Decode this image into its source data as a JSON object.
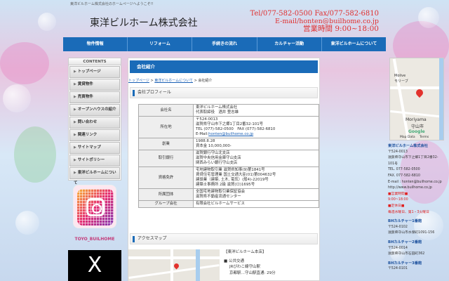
{
  "page": {
    "tagline": "東洋ビルホーム株式会社のホームページへようこそ!!",
    "site_title": "東洋ビルホーム株式会社"
  },
  "contact": {
    "tel_fax": "Tel/077-582-0500 Fax/077-582-6810",
    "email": "E-mail/honten@builhome.co.jp",
    "hours": "営業時間 9:00~18:00"
  },
  "nav": {
    "items": [
      "物件情報",
      "リフォーム",
      "手続きの流れ",
      "カルチャー活動",
      "東洋ビルホームについて"
    ]
  },
  "sidebar": {
    "heading": "CONTENTS",
    "items": [
      "トップページ",
      "賃貸物件",
      "売買物件",
      "オープンハウスの紹介",
      "問い合わせ",
      "関連リンク",
      "サイトマップ",
      "サイトポリシー",
      "東洋ビルホームについて"
    ]
  },
  "instagram": {
    "label": "TOYO_BUILHOME"
  },
  "x_logo": {
    "glyph": "X"
  },
  "main": {
    "heading": "会社紹介",
    "breadcrumb": {
      "home": "トップページ",
      "sep": ">",
      "parent": "東洋ビルホームについて",
      "current": "会社紹介"
    },
    "profile_heading": "会社プロフィール",
    "access_heading": "アクセスマップ",
    "profile": [
      {
        "label": "会社名",
        "lines": [
          "東洋ビルホーム株式会社",
          "代表取締役　酒井 登志雄"
        ]
      },
      {
        "label": "所在地",
        "lines": [
          "〒524-0013",
          "滋賀県守山市下之郷1丁目2番32-101号",
          "TEL (077)-582-0500　FAX (077)-582-6810"
        ],
        "email_prefix": "E-Mail:",
        "email": "honten@builhome.co.jp"
      },
      {
        "label": "創業",
        "lines": [
          "1988.8.28",
          "資本金 10,000,000-"
        ]
      },
      {
        "label": "取引銀行",
        "lines": [
          "滋賀銀行守山北支店",
          "滋賀中央信用金庫守山支店",
          "関西みらい銀行守山支店"
        ]
      },
      {
        "label": "資格免許",
        "lines": [
          "宅地建物取引業 滋賀県知事(9)第1841号",
          "賃貸住宅管理業 国土交通大臣(01)第004632号",
          "建設業（建築, 土木, 電気）(般4)-22019号",
          "建築士事務所 2級 滋賀(ロ)1695号"
        ]
      },
      {
        "label": "所属団体",
        "lines": [
          "全国宅地建物取引業保証協会",
          "滋賀県不動産流通センター"
        ]
      },
      {
        "label": "グループ会社",
        "lines": [
          "有限会社ビルホームサービス"
        ]
      }
    ],
    "access": {
      "office": "【東洋ビルホーム本店】",
      "bullet": "■ 公共交通",
      "line1": "JRびわこ線守山駅",
      "line2": "京都駅…守山駅直通: 29分"
    }
  },
  "gmap": {
    "place_en": "Moriyama",
    "place_jp": "守山市",
    "poi": "Molive",
    "poi_jp": "モリーブ",
    "attribution": "Map Data",
    "terms": "Terms",
    "brand": "Google"
  },
  "right_info": {
    "company": "東洋ビルホーム株式会社",
    "zip": "〒524-0013",
    "addr1": "滋賀県守山市下之郷1丁目2番32-",
    "addr2": "101号",
    "tel": "TEL. 077-582-0500",
    "fax": "FAX. 077-582-6810",
    "email": "E-mail : honten@builhome.co.jp",
    "url": "http://www.builhome.co.jp",
    "hours_label": "■営業時間■",
    "hours": "9:00~18:00",
    "closed_label": "■定休日■",
    "closed": "毎週水曜日、第1・3火曜日",
    "branch1_name": "BHカルチャー1番館",
    "branch1_zip": "〒524-0102",
    "branch1_addr": "滋賀県守山市水保町1091-156",
    "branch2_name": "BHカルチャー2番館",
    "branch2_zip": "〒524-0014",
    "branch2_addr": "滋賀県守山市石田町362",
    "branch3_name": "BHカルチャー3番館",
    "branch3_zip": "〒524-0101"
  },
  "colors": {
    "nav": "#1a6bb8",
    "accent_red": "#e03030",
    "link": "#1a5fb4"
  }
}
